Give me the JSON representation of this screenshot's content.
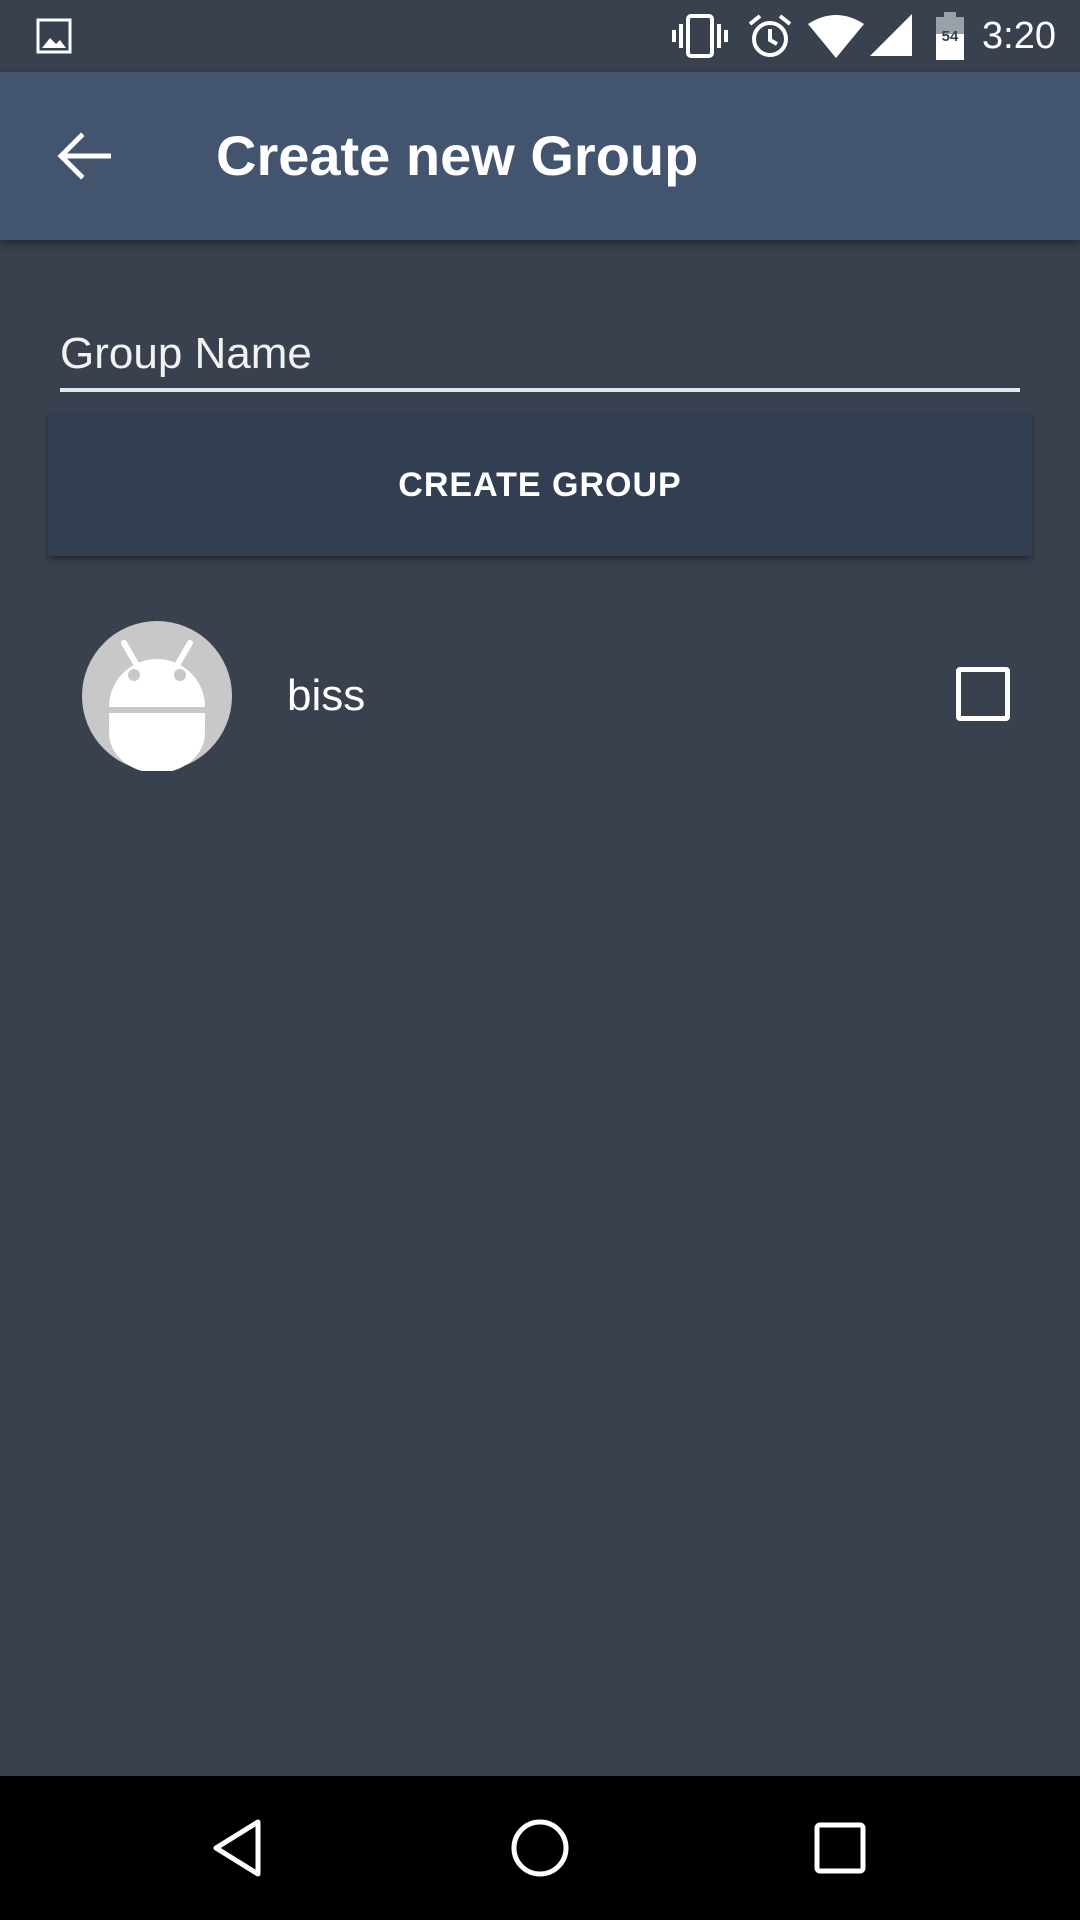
{
  "status_bar": {
    "time": "3:20",
    "battery_level": "54",
    "icons": [
      "image-icon",
      "vibrate-icon",
      "alarm-icon",
      "wifi-icon",
      "cell-signal-icon",
      "battery-icon"
    ]
  },
  "app_bar": {
    "back_icon": "arrow-back-icon",
    "title": "Create new Group"
  },
  "form": {
    "group_name_placeholder": "Group Name",
    "group_name_value": "",
    "create_button_label": "CREATE GROUP"
  },
  "contacts": [
    {
      "name": "biss",
      "avatar_icon": "android-avatar-icon",
      "selected": false
    }
  ],
  "nav_bar": {
    "icons": [
      "back-triangle-icon",
      "home-circle-icon",
      "recents-square-icon"
    ]
  },
  "colors": {
    "background": "#39414e",
    "app_bar": "#43546e",
    "button": "#323f53",
    "nav_bar": "#000000",
    "text": "#ffffff",
    "avatar_bg": "#c8c8c8"
  }
}
